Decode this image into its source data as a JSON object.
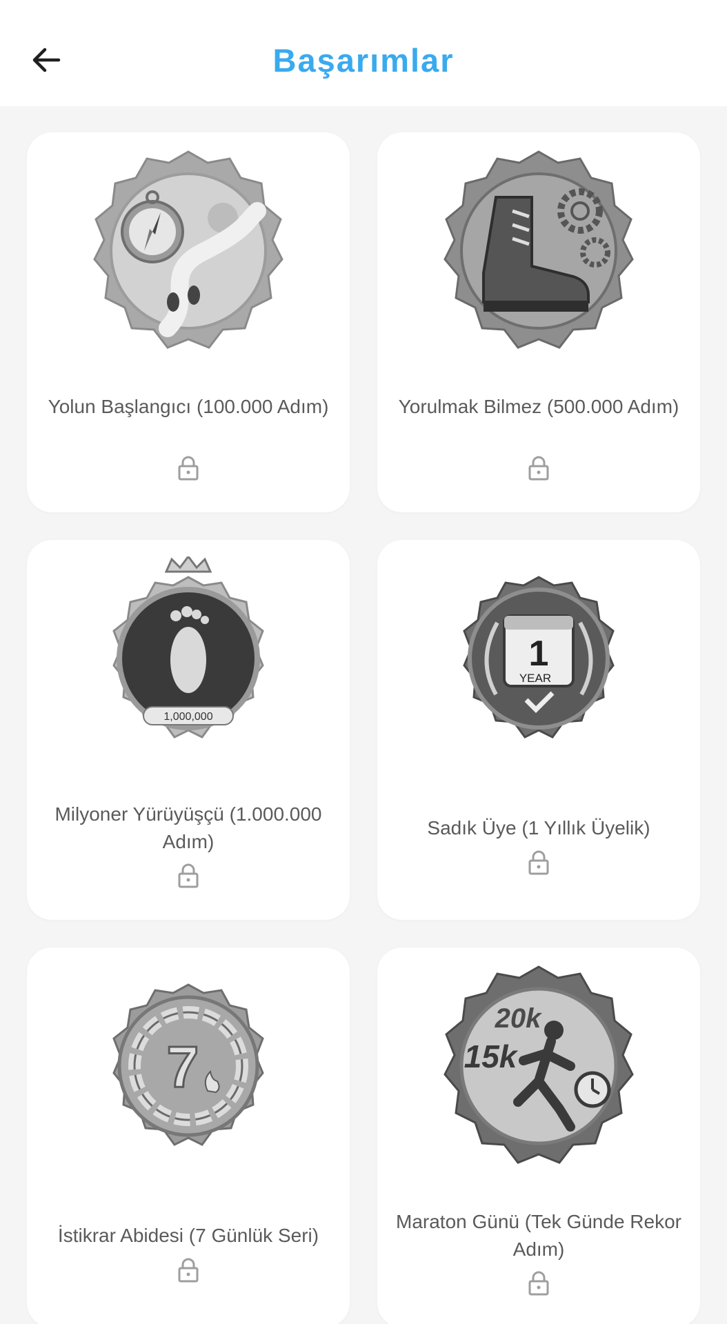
{
  "header": {
    "title": "Başarımlar",
    "title_color": "#3aaaee",
    "back_icon": "arrow-left-icon"
  },
  "achievements": [
    {
      "title": "Yolun Başlangıcı (100.000 Adım)",
      "badge_icon": "compass-path-badge-icon",
      "locked": true
    },
    {
      "title": "Yorulmak Bilmez (500.000 Adım)",
      "badge_icon": "boot-gears-badge-icon",
      "locked": true
    },
    {
      "title": "Milyoner Yürüyüşçü (1.000.000 Adım)",
      "badge_icon": "footprint-crown-badge-icon",
      "badge_text": "1,000,000",
      "locked": true
    },
    {
      "title": "Sadık Üye (1 Yıllık Üyelik)",
      "badge_icon": "calendar-laurel-badge-icon",
      "badge_text_num": "1",
      "badge_text_word": "YEAR",
      "locked": true
    },
    {
      "title": "İstikrar Abidesi (7 Günlük Seri)",
      "badge_icon": "chain-seven-badge-icon",
      "badge_text": "7",
      "locked": true
    },
    {
      "title": "Maraton Günü (Tek Günde Rekor Adım)",
      "badge_icon": "runner-badge-icon",
      "badge_text_top": "20k",
      "badge_text_bottom": "15k",
      "locked": true
    }
  ]
}
